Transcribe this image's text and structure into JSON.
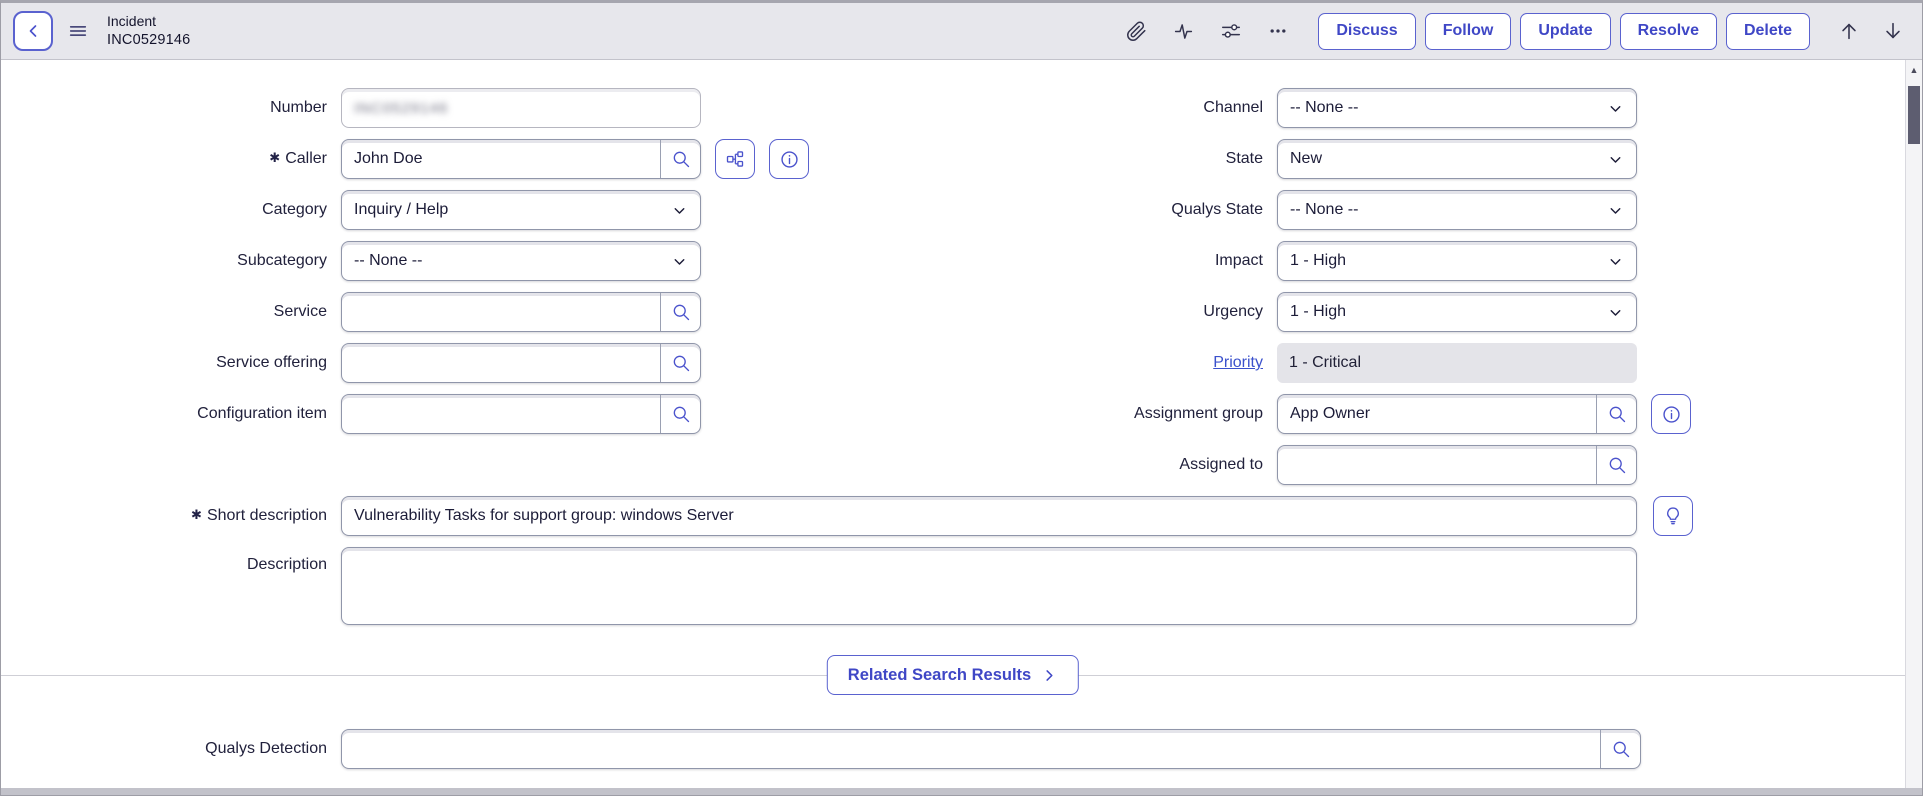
{
  "colors": {
    "accent": "#424BC9",
    "header_bg": "#E7E7EC",
    "readonly_bg": "#E4E4E9",
    "link": "#3B51CC"
  },
  "required_marker": "✱",
  "header": {
    "title": "Incident",
    "record_number": "INC0529146",
    "toolbar_icons": {
      "attachment": "paperclip",
      "activity": "pulse",
      "personalize": "sliders",
      "more": "ellipsis"
    },
    "nav_icons": {
      "back": "chevron-left",
      "menu": "hamburger",
      "scroll_up": "arrow-up",
      "scroll_down": "arrow-down"
    },
    "buttons": {
      "discuss": "Discuss",
      "follow": "Follow",
      "update": "Update",
      "resolve": "Resolve",
      "delete": "Delete"
    }
  },
  "form": {
    "left": {
      "number": {
        "label": "Number",
        "value": "INC0529146",
        "redacted": true
      },
      "caller": {
        "label": "Caller",
        "value": "John Doe",
        "required": true
      },
      "category": {
        "label": "Category",
        "value": "Inquiry / Help"
      },
      "subcategory": {
        "label": "Subcategory",
        "value": "-- None --"
      },
      "service": {
        "label": "Service",
        "value": ""
      },
      "service_offering": {
        "label": "Service offering",
        "value": ""
      },
      "configuration_item": {
        "label": "Configuration item",
        "value": ""
      }
    },
    "right": {
      "channel": {
        "label": "Channel",
        "value": "-- None --"
      },
      "state": {
        "label": "State",
        "value": "New"
      },
      "qualys_state": {
        "label": "Qualys State",
        "value": "-- None --"
      },
      "impact": {
        "label": "Impact",
        "value": "1 - High"
      },
      "urgency": {
        "label": "Urgency",
        "value": "1 - High"
      },
      "priority": {
        "label": "Priority",
        "value": "1 - Critical",
        "readonly": true
      },
      "assignment_group": {
        "label": "Assignment group",
        "value": "App Owner"
      },
      "assigned_to": {
        "label": "Assigned to",
        "value": ""
      }
    },
    "short_description": {
      "label": "Short description",
      "value": "Vulnerability Tasks for support group: windows Server",
      "required": true
    },
    "description": {
      "label": "Description",
      "value": ""
    },
    "related_search_button": "Related Search Results",
    "qualys_detection": {
      "label": "Qualys Detection",
      "value": ""
    }
  }
}
